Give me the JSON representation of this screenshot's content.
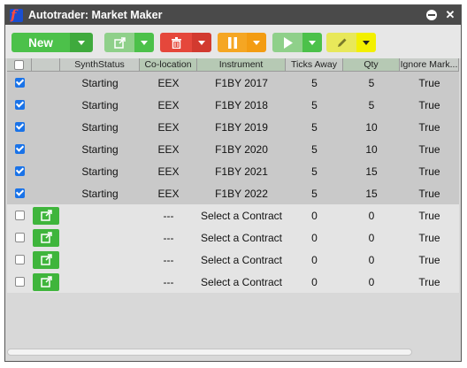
{
  "window": {
    "title": "Autotrader: Market Maker",
    "app_icon_letter": "f"
  },
  "toolbar": {
    "new_label": "New",
    "colors": {
      "new": "#4cc14a",
      "launch": "#8fd08a",
      "delete": "#e5473b",
      "pause": "#f5a623",
      "play": "#8fd08a",
      "edit": "#e8e85a",
      "edit_drop": "#f3f000"
    }
  },
  "columns": [
    "",
    "",
    "SynthStatus",
    "Co-location",
    "Instrument",
    "Ticks Away",
    "Qty",
    "Ignore Mark..."
  ],
  "rows": [
    {
      "checked": true,
      "status": "Starting",
      "colo": "EEX",
      "instrument": "F1BY 2017",
      "ticks": "5",
      "qty": "5",
      "ignore": "True"
    },
    {
      "checked": true,
      "status": "Starting",
      "colo": "EEX",
      "instrument": "F1BY 2018",
      "ticks": "5",
      "qty": "5",
      "ignore": "True"
    },
    {
      "checked": true,
      "status": "Starting",
      "colo": "EEX",
      "instrument": "F1BY 2019",
      "ticks": "5",
      "qty": "10",
      "ignore": "True"
    },
    {
      "checked": true,
      "status": "Starting",
      "colo": "EEX",
      "instrument": "F1BY 2020",
      "ticks": "5",
      "qty": "10",
      "ignore": "True"
    },
    {
      "checked": true,
      "status": "Starting",
      "colo": "EEX",
      "instrument": "F1BY 2021",
      "ticks": "5",
      "qty": "15",
      "ignore": "True"
    },
    {
      "checked": true,
      "status": "Starting",
      "colo": "EEX",
      "instrument": "F1BY 2022",
      "ticks": "5",
      "qty": "15",
      "ignore": "True"
    },
    {
      "checked": false,
      "status": "",
      "colo": "---",
      "instrument": "Select a Contract",
      "ticks": "0",
      "qty": "0",
      "ignore": "True"
    },
    {
      "checked": false,
      "status": "",
      "colo": "---",
      "instrument": "Select a Contract",
      "ticks": "0",
      "qty": "0",
      "ignore": "True"
    },
    {
      "checked": false,
      "status": "",
      "colo": "---",
      "instrument": "Select a Contract",
      "ticks": "0",
      "qty": "0",
      "ignore": "True"
    },
    {
      "checked": false,
      "status": "",
      "colo": "---",
      "instrument": "Select a Contract",
      "ticks": "0",
      "qty": "0",
      "ignore": "True"
    }
  ]
}
